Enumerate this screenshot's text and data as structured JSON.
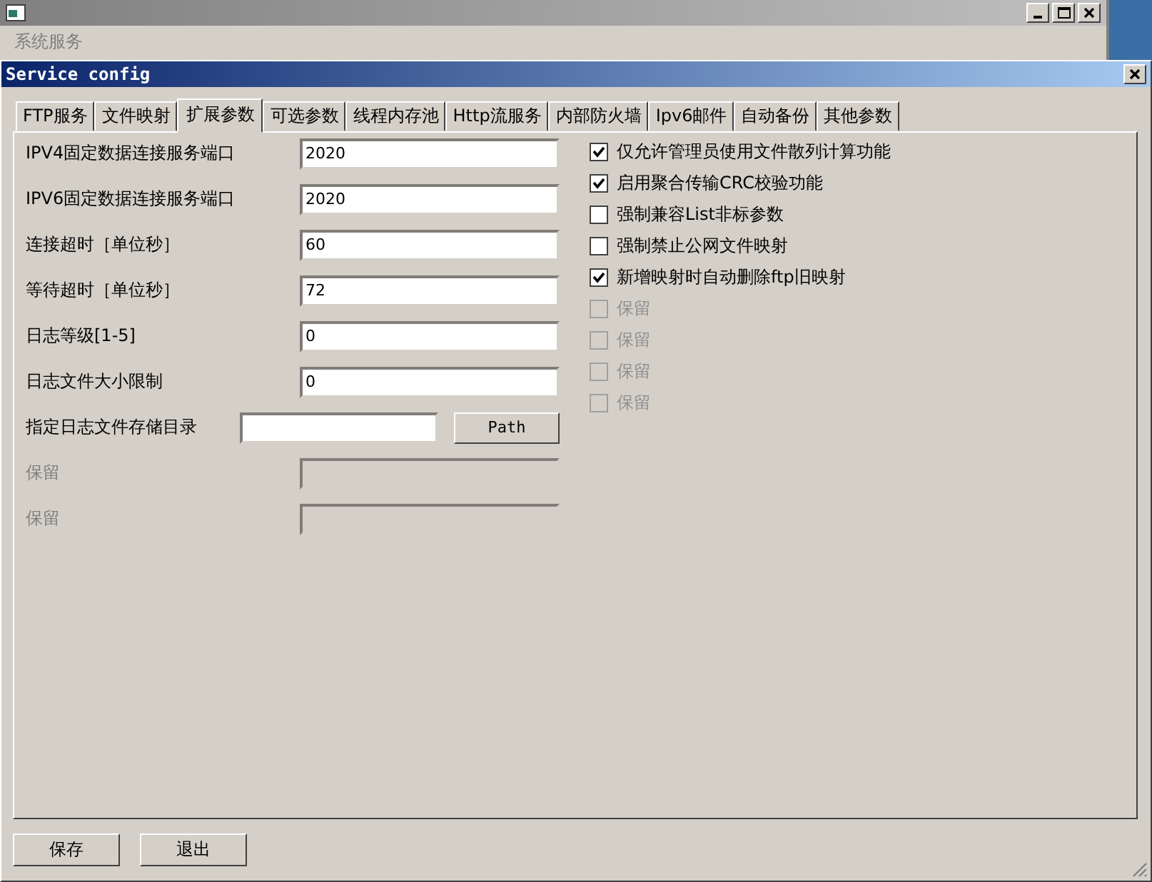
{
  "background_window": {
    "menu": [
      {
        "label": "系统服务",
        "disabled": true
      }
    ]
  },
  "dialog": {
    "title": "Service config"
  },
  "tabs": [
    {
      "label": "FTP服务",
      "selected": false
    },
    {
      "label": "文件映射",
      "selected": false
    },
    {
      "label": "扩展参数",
      "selected": true
    },
    {
      "label": "可选参数",
      "selected": false
    },
    {
      "label": "线程内存池",
      "selected": false
    },
    {
      "label": "Http流服务",
      "selected": false
    },
    {
      "label": "内部防火墙",
      "selected": false
    },
    {
      "label": "Ipv6邮件",
      "selected": false
    },
    {
      "label": "自动备份",
      "selected": false
    },
    {
      "label": "其他参数",
      "selected": false
    }
  ],
  "fields": [
    {
      "kind": "text",
      "label": "IPV4固定数据连接服务端口",
      "value": "2020",
      "disabled": false
    },
    {
      "kind": "text",
      "label": "IPV6固定数据连接服务端口",
      "value": "2020",
      "disabled": false
    },
    {
      "kind": "text",
      "label": "连接超时［单位秒］",
      "value": "60",
      "disabled": false
    },
    {
      "kind": "text",
      "label": "等待超时［单位秒］",
      "value": "72",
      "disabled": false
    },
    {
      "kind": "text",
      "label": "日志等级[1-5]",
      "value": "0",
      "disabled": false
    },
    {
      "kind": "text",
      "label": "日志文件大小限制",
      "value": "0",
      "disabled": false
    },
    {
      "kind": "path",
      "label": "指定日志文件存储目录",
      "button": "Path",
      "disabled": false
    },
    {
      "kind": "text",
      "label": "保留",
      "disabled": true
    },
    {
      "kind": "text",
      "label": "保留",
      "disabled": true
    }
  ],
  "options": [
    {
      "label": "仅允许管理员使用文件散列计算功能",
      "checked": true,
      "disabled": false
    },
    {
      "label": "启用聚合传输CRC校验功能",
      "checked": true,
      "disabled": false
    },
    {
      "label": "强制兼容List非标参数",
      "checked": false,
      "disabled": false
    },
    {
      "label": "强制禁止公网文件映射",
      "checked": false,
      "disabled": false
    },
    {
      "label": "新增映射时自动删除ftp旧映射",
      "checked": true,
      "disabled": false
    },
    {
      "label": "保留",
      "checked": false,
      "disabled": true
    },
    {
      "label": "保留",
      "checked": false,
      "disabled": true
    },
    {
      "label": "保留",
      "checked": false,
      "disabled": true
    },
    {
      "label": "保留",
      "checked": false,
      "disabled": true
    }
  ],
  "buttons": [
    {
      "label": "保存"
    },
    {
      "label": "退出"
    }
  ]
}
